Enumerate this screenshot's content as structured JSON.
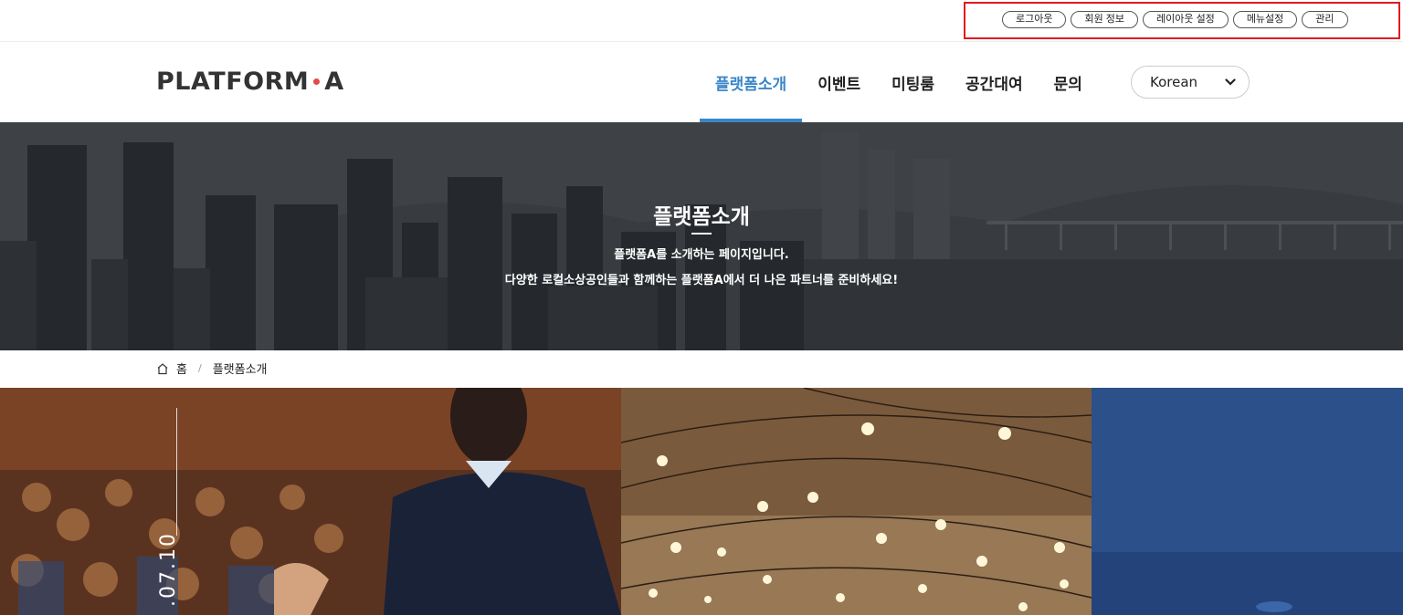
{
  "util": {
    "buttons": [
      "로그아웃",
      "회원 정보",
      "레이아웃 설정",
      "메뉴설정",
      "관리"
    ]
  },
  "header": {
    "logo_left": "PLATFORM",
    "logo_right": "A",
    "nav": [
      "플랫폼소개",
      "이벤트",
      "미팅룸",
      "공간대여",
      "문의"
    ],
    "active_nav": "플랫폼소개",
    "language": "Korean"
  },
  "hero": {
    "title": "플랫폼소개",
    "line1": "플랫폼A를 소개하는 페이지입니다.",
    "line2": "다양한 로컬소상공인들과 함께하는 플랫폼A에서 더 나은 파트너를 준비하세요!"
  },
  "breadcrumb": {
    "home": "홈",
    "separator": "/",
    "current": "플랫폼소개"
  },
  "panels": {
    "date_fragment": ".07.10"
  },
  "colors": {
    "accent": "#3a86c8",
    "highlight_box": "#e0191f",
    "logo_dot": "#e24a4a"
  }
}
